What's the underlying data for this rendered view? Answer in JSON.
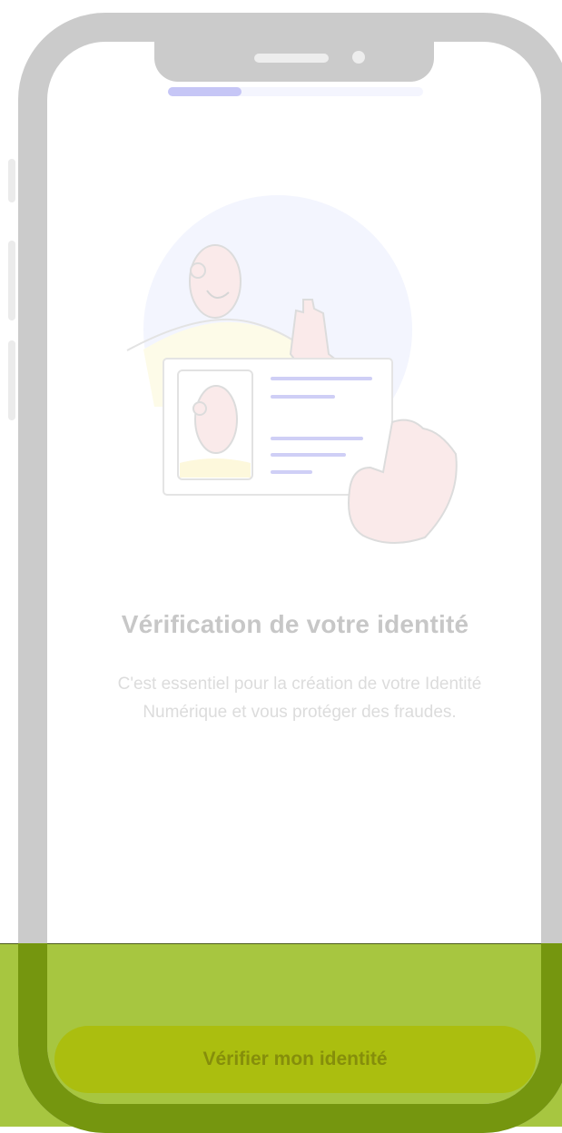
{
  "onboarding": {
    "progress_fraction": 0.29,
    "title": "Vérification de votre identité",
    "subtitle_line1": "C'est essentiel pour la création de votre Identité",
    "subtitle_line2": "Numérique et vous protéger des fraudes.",
    "cta_label": "Vérifier mon identité"
  },
  "colors": {
    "accent_green": "#abbe0f",
    "band_green": "#a7c640",
    "progress_fill": "#c6c6f6"
  },
  "icons": {
    "illustration": "person-holding-id-card-icon"
  }
}
